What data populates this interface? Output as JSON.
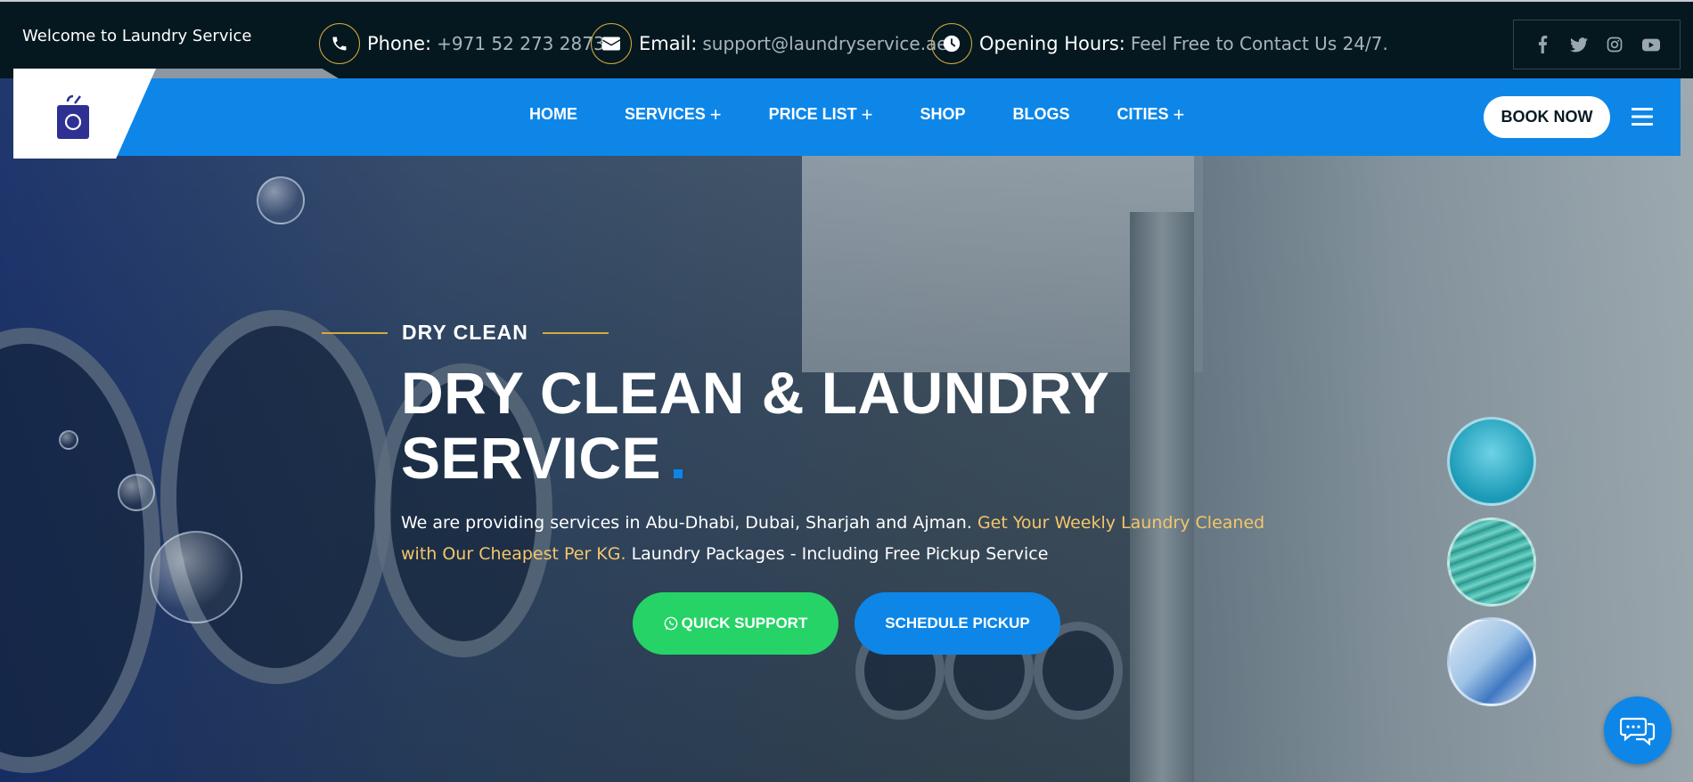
{
  "topbar": {
    "welcome": "Welcome to Laundry Service",
    "phone": {
      "label": "Phone:",
      "value": "+971 52 273 2873",
      "icon": "phone-icon"
    },
    "email": {
      "label": "Email:",
      "value": "support@laundryservice.ae",
      "icon": "envelope-icon"
    },
    "hours": {
      "label": "Opening Hours:",
      "value": "Feel Free to Contact Us 24/7.",
      "icon": "clock-icon"
    },
    "social": [
      "facebook-icon",
      "twitter-icon",
      "instagram-icon",
      "youtube-icon"
    ]
  },
  "nav": {
    "items": [
      {
        "label": "HOME",
        "has_plus": false
      },
      {
        "label": "SERVICES",
        "has_plus": true
      },
      {
        "label": "PRICE LIST",
        "has_plus": true
      },
      {
        "label": "SHOP",
        "has_plus": false
      },
      {
        "label": "BLOGS",
        "has_plus": false
      },
      {
        "label": "CITIES",
        "has_plus": true
      }
    ],
    "plus": "+",
    "book_now": "BOOK NOW"
  },
  "hero": {
    "eyebrow": "DRY CLEAN",
    "title_line1": "DRY CLEAN & LAUNDRY",
    "title_line2": "SERVICE",
    "desc_part1": "We are providing services in Abu-Dhabi, Dubai, Sharjah and Ajman. ",
    "desc_highlight": "Get Your Weekly Laundry Cleaned with Our Cheapest Per KG.",
    "desc_part2": " Laundry Packages - Including Free Pickup Service",
    "btn_support": "QUICK SUPPORT",
    "btn_schedule": "SCHEDULE PICKUP"
  },
  "colors": {
    "topbar_bg": "#051820",
    "nav_blue": "#0d86e8",
    "gold": "#d6a93d",
    "highlight": "#f4c66a",
    "whatsapp_green": "#25d366"
  }
}
